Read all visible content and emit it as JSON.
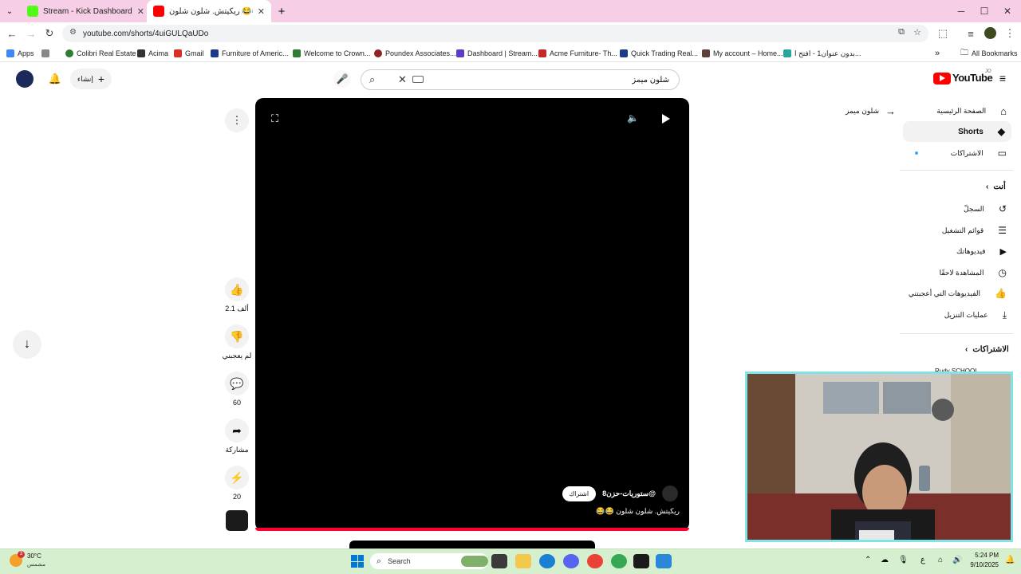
{
  "browser": {
    "tabs": [
      {
        "title": "Stream - Kick Dashboard",
        "favicon_color": "#53fc18"
      },
      {
        "title": "ريكيتش. شلون شلون 😂😂 - ...",
        "favicon_color": "#ff0000"
      }
    ],
    "url": "youtube.com/shorts/4uiGULQaUDo",
    "bookmarks": [
      {
        "label": "Apps",
        "color": "#4285f4"
      },
      {
        "label": "Colibri Real Estate",
        "color": "#2e7d32"
      },
      {
        "label": "Acima",
        "color": "#333333"
      },
      {
        "label": "Gmail",
        "color": "#d93025"
      },
      {
        "label": "Furniture of Americ...",
        "color": "#1a3a8a"
      },
      {
        "label": "Welcome to Crown...",
        "color": "#2e7d32"
      },
      {
        "label": "Poundex Associates...",
        "color": "#8e2424"
      },
      {
        "label": "Dashboard | Stream...",
        "color": "#5b3cc4"
      },
      {
        "label": "Acme Furniture- Th...",
        "color": "#c62828"
      },
      {
        "label": "Quick Trading Real...",
        "color": "#1a3a8a"
      },
      {
        "label": "My account – Home...",
        "color": "#5d4037"
      },
      {
        "label": "بدون عنوان1 - افتح ا...",
        "color": "#26a69a"
      }
    ],
    "all_bookmarks_label": "All Bookmarks"
  },
  "yt": {
    "logo_text": "YouTube",
    "logo_country": "JO",
    "create_label": "إنشاء",
    "search_value": "شلون ميمز",
    "back_label": "شلون ميمز",
    "sidebar": {
      "main": [
        {
          "label": "الصفحة الرئيسية",
          "icon": "home-icon"
        },
        {
          "label": "Shorts",
          "icon": "shorts-icon"
        },
        {
          "label": "الاشتراكات",
          "icon": "subscriptions-icon"
        }
      ],
      "you_header": "أنت",
      "you_items": [
        {
          "label": "السجلّ",
          "icon": "history-icon"
        },
        {
          "label": "قوائم التشغيل",
          "icon": "playlists-icon"
        },
        {
          "label": "فيديوهاتك",
          "icon": "your-videos-icon"
        },
        {
          "label": "المشاهدة لاحقًا",
          "icon": "watch-later-icon"
        },
        {
          "label": "الفيديوهات التي أعجبتني",
          "icon": "liked-icon"
        },
        {
          "label": "عمليات التنزيل",
          "icon": "download-icon"
        }
      ],
      "subs_header": "الاشتراكات",
      "subs_item": "Rudy SCHOOL"
    },
    "short": {
      "channel": "@ستوريات-حزن8",
      "subscribe_label": "اشتراك",
      "title": "ريكيتش. شلون شلون 😂😂"
    },
    "actions": [
      {
        "label": "2.1 ألف",
        "icon": "like-icon",
        "glyph": "👍"
      },
      {
        "label": "لم يعجبني",
        "icon": "dislike-icon",
        "glyph": "👎"
      },
      {
        "label": "60",
        "icon": "comments-icon",
        "glyph": "💬"
      },
      {
        "label": "مشاركة",
        "icon": "share-icon",
        "glyph": "➦"
      },
      {
        "label": "20",
        "icon": "remix-icon",
        "glyph": "⚡"
      }
    ]
  },
  "taskbar": {
    "weather_temp": "30°C",
    "weather_desc": "مشمس",
    "weather_badge": "3",
    "search_label": "Search",
    "lang": "ع",
    "time": "5:24 PM",
    "date": "9/10/2025"
  }
}
